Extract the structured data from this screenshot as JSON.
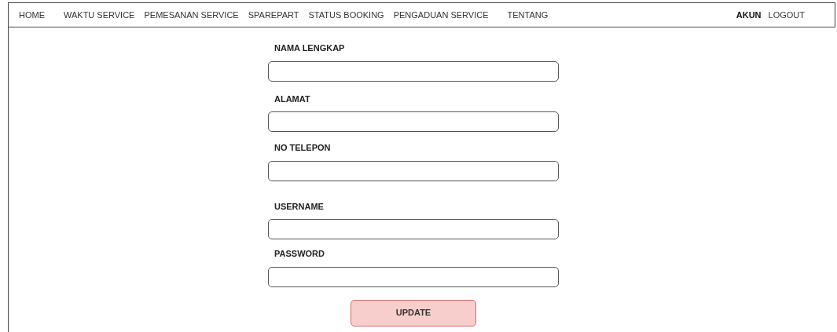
{
  "nav": {
    "items": [
      {
        "label": "HOME",
        "selected": false
      },
      {
        "label": "WAKTU SERVICE",
        "selected": false
      },
      {
        "label": "PEMESANAN SERVICE",
        "selected": false
      },
      {
        "label": "SPAREPART",
        "selected": false
      },
      {
        "label": "STATUS BOOKING",
        "selected": false
      },
      {
        "label": "PENGADUAN SERVICE",
        "selected": false
      },
      {
        "label": "TENTANG",
        "selected": false
      }
    ],
    "right_items": [
      {
        "label": "AKUN",
        "selected": true
      },
      {
        "label": "LOGOUT",
        "selected": false
      }
    ]
  },
  "form": {
    "fields": [
      {
        "label": "NAMA LENGKAP"
      },
      {
        "label": "ALAMAT"
      },
      {
        "label": "NO TELEPON"
      },
      {
        "label": "USERNAME"
      },
      {
        "label": "PASSWORD"
      }
    ],
    "button": "UPDATE"
  }
}
